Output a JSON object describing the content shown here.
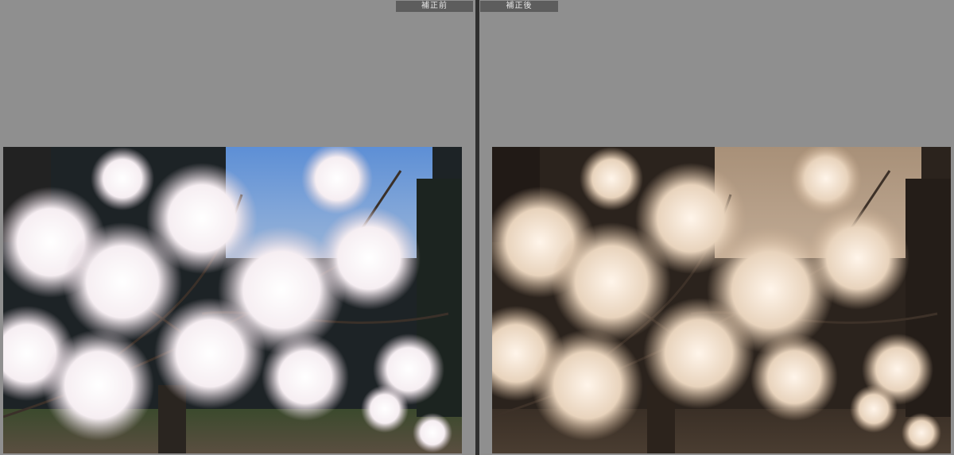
{
  "labels": {
    "before": "補正前",
    "after": "補正後"
  },
  "colors": {
    "background": "#8e8e8e",
    "divider": "#2f2f2f",
    "label_bg": "#5d5d5d",
    "label_text": "#e6e6e6",
    "sky_before": "#4f86cf",
    "sepia_tone": "#bfa58a"
  },
  "images": {
    "before": "cherry-blossom-photo-original",
    "after": "cherry-blossom-photo-sepia"
  }
}
